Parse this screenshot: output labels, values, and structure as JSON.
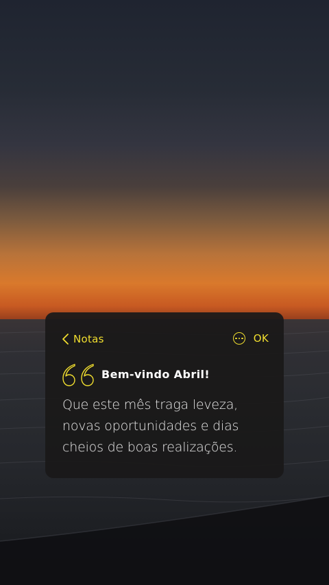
{
  "nav": {
    "back_label": "Notas",
    "ok_label": "OK"
  },
  "note": {
    "title": "Bem-vindo Abril!",
    "body_lines": [
      "Que este mês traga leveza,",
      "novas oportunidades e dias",
      "cheios de boas realizações."
    ]
  },
  "icons": {
    "back": "chevron-left-icon",
    "more": "ellipsis-circle-icon",
    "quote": "quote-icon"
  },
  "colors": {
    "accent": "#f2df2f",
    "card_background": "#1a1919",
    "title": "#ffffff",
    "body": "#e8e8e8"
  }
}
